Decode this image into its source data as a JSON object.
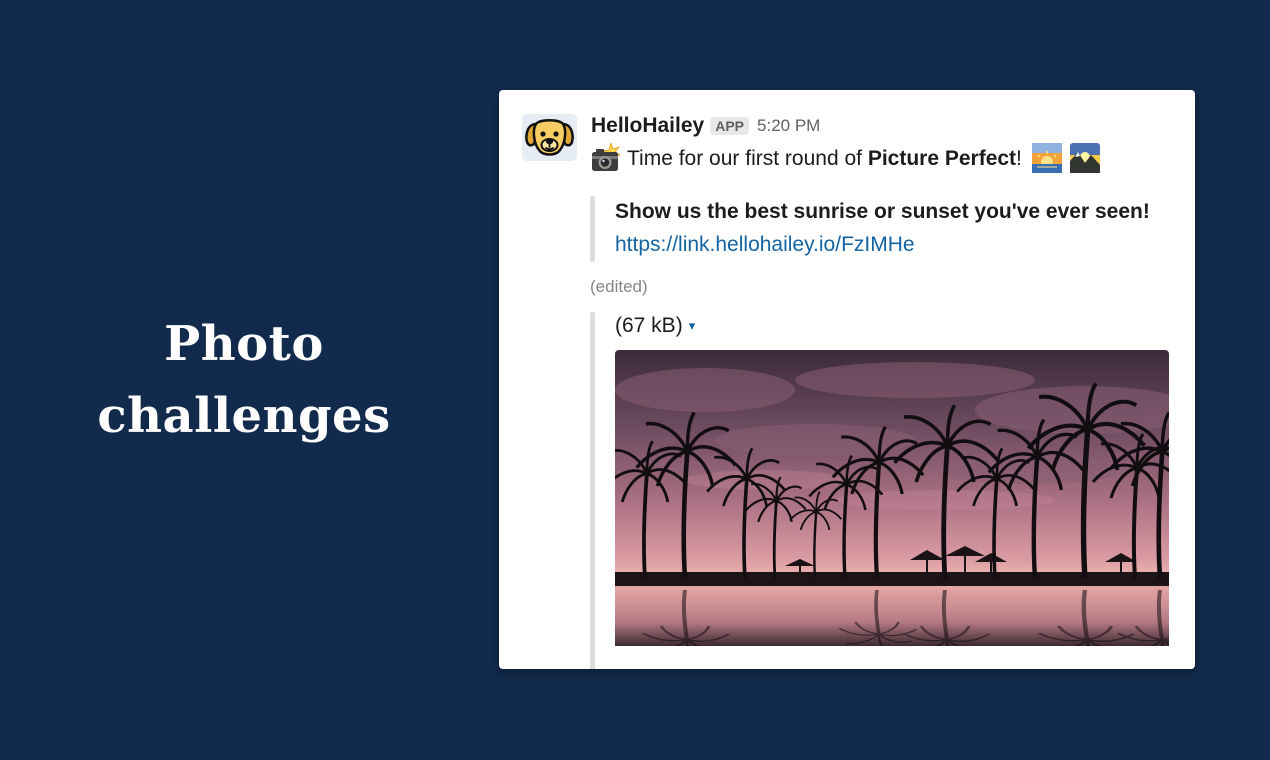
{
  "headline": {
    "line1": "Photo",
    "line2": "challenges"
  },
  "message": {
    "sender": "HelloHailey",
    "badge": "APP",
    "time": "5:20 PM",
    "text_prefix": "Time for our first round of ",
    "text_bold": "Picture Perfect",
    "text_suffix": "!",
    "emojis": [
      "camera-flash-icon",
      "sunrise-icon",
      "sunrise-over-mountains-icon"
    ]
  },
  "attachment": {
    "title": "Show us the best sunrise or sunset you've ever seen!",
    "link": "https://link.hellohailey.io/FzIMHe"
  },
  "edited_label": "(edited)",
  "file": {
    "size_label": "(67 kB)",
    "caret": "▾"
  },
  "colors": {
    "background": "#122b4d",
    "link": "#1264a3",
    "quote_bar": "#dddddd"
  }
}
